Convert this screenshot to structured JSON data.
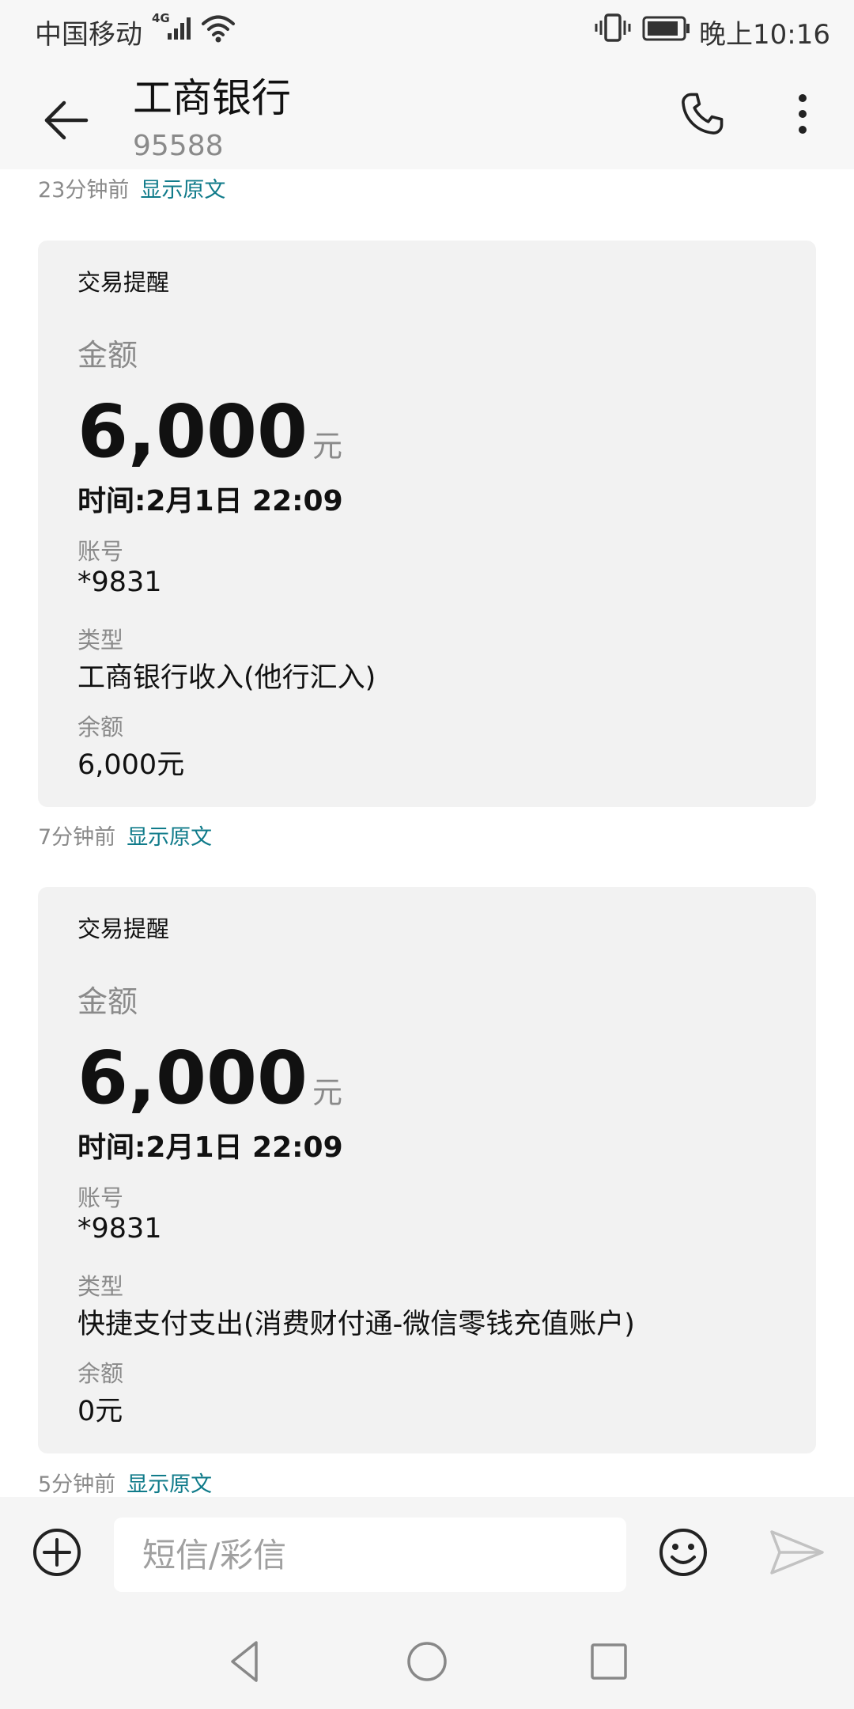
{
  "status_bar": {
    "carrier": "中国移动",
    "network_type": "4G",
    "time": "晚上10:16",
    "icons": [
      "signal-icon",
      "wifi-icon",
      "vibrate-icon",
      "battery-icon"
    ]
  },
  "header": {
    "contact_name": "工商银行",
    "contact_number": "95588",
    "icons": [
      "back-arrow-icon",
      "phone-icon",
      "more-vertical-icon"
    ]
  },
  "messages": [
    {
      "time_ago": "23分钟前",
      "show_original": "显示原文"
    },
    {
      "card": {
        "title": "交易提醒",
        "amount_label": "金额",
        "amount": "6,000",
        "amount_unit": "元",
        "time": "时间:2月1日 22:09",
        "account_label": "账号",
        "account": "*9831",
        "type_label": "类型",
        "type": "工商银行收入(他行汇入)",
        "balance_label": "余额",
        "balance": "6,000元"
      },
      "time_ago": "7分钟前",
      "show_original": "显示原文"
    },
    {
      "card": {
        "title": "交易提醒",
        "amount_label": "金额",
        "amount": "6,000",
        "amount_unit": "元",
        "time": "时间:2月1日 22:09",
        "account_label": "账号",
        "account": "*9831",
        "type_label": "类型",
        "type": "快捷支付支出(消费财付通-微信零钱充值账户)",
        "balance_label": "余额",
        "balance": "0元"
      },
      "time_ago": "5分钟前",
      "show_original": "显示原文"
    }
  ],
  "input_bar": {
    "placeholder": "短信/彩信",
    "icons": [
      "add-circle-icon",
      "emoji-icon",
      "send-icon"
    ]
  },
  "nav_bar": {
    "icons": [
      "nav-back-icon",
      "nav-home-icon",
      "nav-recent-icon"
    ]
  },
  "colors": {
    "link": "#107b8a",
    "card_background": "#f2f2f2",
    "secondary_text": "#8a8a8a",
    "bar_background": "#f7f7f7"
  }
}
